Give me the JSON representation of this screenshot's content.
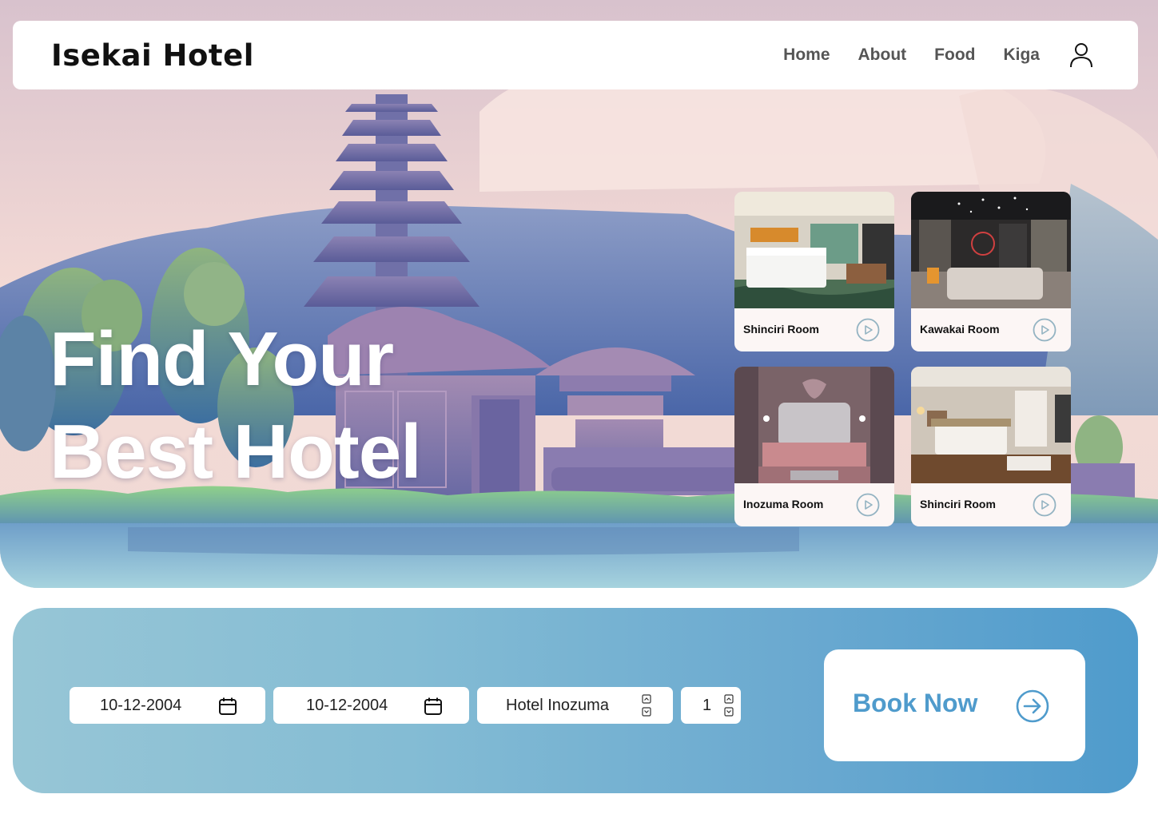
{
  "brand": {
    "name": "Isekai Hotel"
  },
  "nav": {
    "links": [
      {
        "label": "Home"
      },
      {
        "label": "About"
      },
      {
        "label": "Food"
      },
      {
        "label": "Kiga"
      }
    ],
    "profile_icon": "user-icon"
  },
  "hero": {
    "headline_line1": "Find Your",
    "headline_line2": "Best Hotel"
  },
  "rooms": [
    {
      "name": "Shinciri Room",
      "icon": "play-icon"
    },
    {
      "name": "Kawakai Room",
      "icon": "play-icon"
    },
    {
      "name": "Inozuma Room",
      "icon": "play-icon"
    },
    {
      "name": "Shinciri Room",
      "icon": "play-icon"
    }
  ],
  "booking": {
    "check_in": "10-12-2004",
    "check_out": "10-12-2004",
    "hotel": "Hotel Inozuma",
    "guests": "1",
    "button_label": "Book Now",
    "icons": [
      "calendar-icon",
      "stepper-icon",
      "arrow-right-icon"
    ]
  },
  "colors": {
    "accent": "#4f9bcc",
    "nav_text": "#555555",
    "card_bg": "#fcf6f5"
  }
}
